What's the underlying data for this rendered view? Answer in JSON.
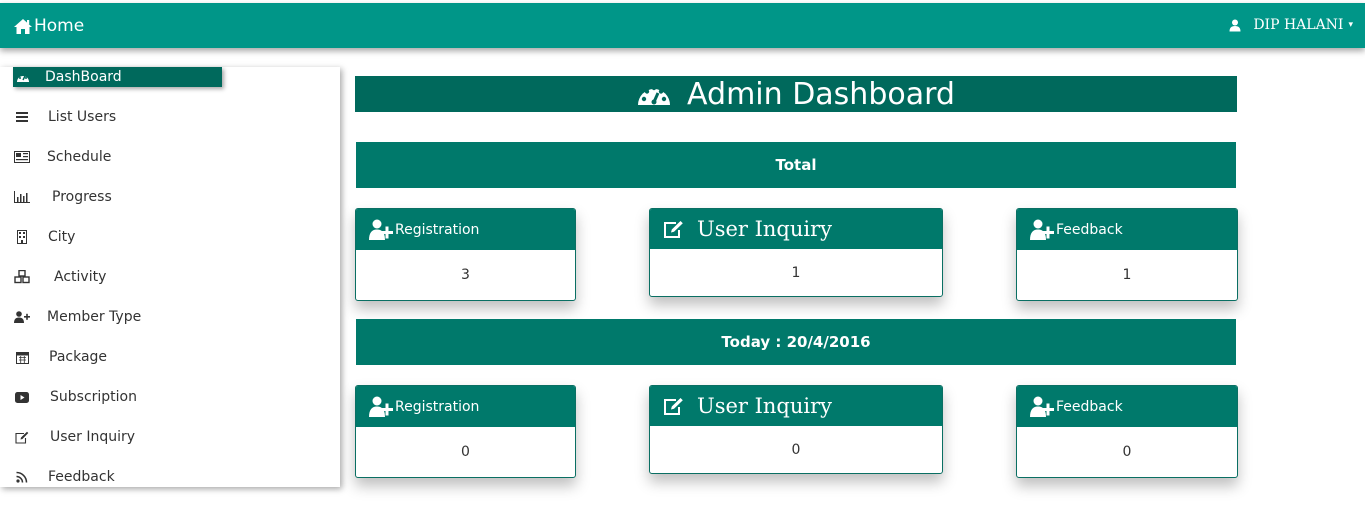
{
  "header": {
    "title": "Home",
    "user_name": "DIP HALANI",
    "caret": "▾"
  },
  "sidebar": {
    "items": [
      {
        "label": "DashBoard",
        "icon": "dashboard-icon",
        "active": true
      },
      {
        "label": "List Users",
        "icon": "list-icon"
      },
      {
        "label": "Schedule",
        "icon": "newspaper-icon"
      },
      {
        "label": "Progress",
        "icon": "bar-chart-icon"
      },
      {
        "label": "City",
        "icon": "building-icon"
      },
      {
        "label": "Activity",
        "icon": "cubes-icon"
      },
      {
        "label": "Member Type",
        "icon": "user-plus-icon"
      },
      {
        "label": "Package",
        "icon": "calendar-icon"
      },
      {
        "label": "Subscription",
        "icon": "youtube-play-icon"
      },
      {
        "label": "User Inquiry",
        "icon": "edit-icon"
      },
      {
        "label": "Feedback",
        "icon": "rss-icon"
      }
    ]
  },
  "main": {
    "title": "Admin Dashboard",
    "total": {
      "label": "Total",
      "cards": [
        {
          "label": "Registration",
          "value": "3"
        },
        {
          "label": "User Inquiry",
          "value": "1"
        },
        {
          "label": "Feedback",
          "value": "1"
        }
      ]
    },
    "today": {
      "label": "Today : 20/4/2016",
      "cards": [
        {
          "label": "Registration",
          "value": "0"
        },
        {
          "label": "User Inquiry",
          "value": "0"
        },
        {
          "label": "Feedback",
          "value": "0"
        }
      ]
    }
  },
  "colors": {
    "topbar": "#009688",
    "primary_dark": "#00695c",
    "primary": "#00796b"
  }
}
